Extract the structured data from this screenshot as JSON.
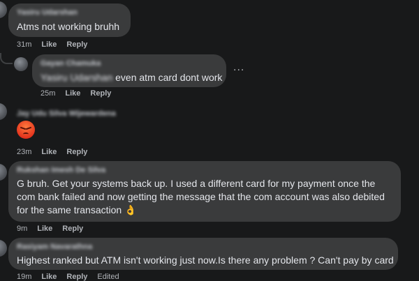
{
  "actions": {
    "like": "Like",
    "reply": "Reply"
  },
  "comments": [
    {
      "author": "Yasiru Udarshan",
      "text": "Atms not working bruhh",
      "time": "31m"
    },
    {
      "author": "Gayan Chamuka",
      "mention": "Yasiru Udarshan",
      "text": " even atm card dont work",
      "time": "25m",
      "more": "..."
    },
    {
      "author": "Jay Udu Silva Wijewardena",
      "emoji": "angry-face",
      "time": "23m"
    },
    {
      "author": "Rukshan Imesh De Silva",
      "text": "G bruh. Get your systems back up. I used a different card for my payment once the com bank failed and now getting the message that the com account was also debited for the same transaction 👌",
      "time": "9m"
    },
    {
      "author": "Rasiyam Navarathna",
      "text": "Highest ranked but ATM isn't working just now.Is there any problem ? Can't pay by card",
      "time": "19m",
      "edited": "Edited"
    }
  ],
  "colors": {
    "background": "#18191a",
    "bubble": "#3a3b3c",
    "text": "#e4e6eb",
    "meta": "#b0b3b8"
  }
}
